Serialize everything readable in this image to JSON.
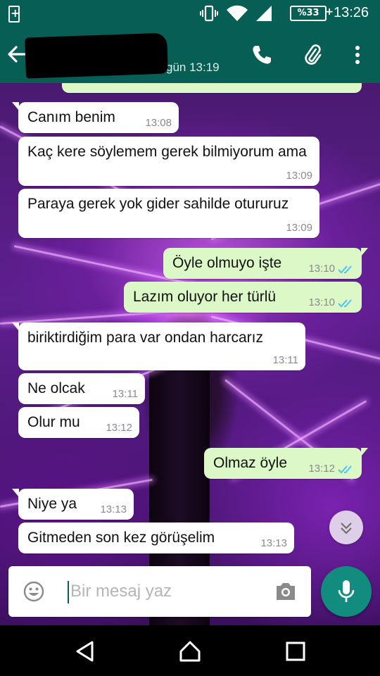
{
  "status_bar": {
    "battery_text": "%33",
    "time": "13:26"
  },
  "header": {
    "last_seen": "gün 13:19"
  },
  "messages": [
    {
      "dir": "in",
      "text": "Canım benim",
      "time": "13:08"
    },
    {
      "dir": "in",
      "text": "Kaç kere söylemem gerek bilmiyorum ama",
      "time": "13:09"
    },
    {
      "dir": "in",
      "text": "Paraya gerek yok gider sahilde otururuz",
      "time": "13:09"
    },
    {
      "dir": "out",
      "text": "Öyle olmuyo işte",
      "time": "13:10"
    },
    {
      "dir": "out",
      "text": "Lazım oluyor her türlü",
      "time": "13:10"
    },
    {
      "dir": "in",
      "text": "biriktirdiğim para var ondan harcarız",
      "time": "13:11"
    },
    {
      "dir": "in",
      "text": "Ne olcak",
      "time": "13:11"
    },
    {
      "dir": "in",
      "text": "Olur mu",
      "time": "13:12"
    },
    {
      "dir": "out",
      "text": "Olmaz öyle",
      "time": "13:12"
    },
    {
      "dir": "in",
      "text": "Niye ya",
      "time": "13:13"
    },
    {
      "dir": "in",
      "text": "Gitmeden son kez görüşelim",
      "time": "13:13"
    }
  ],
  "input": {
    "placeholder": "Bir mesaj yaz"
  },
  "colors": {
    "header": "#075e54",
    "outgoing": "#dcf8c6",
    "incoming": "#ffffff",
    "fab": "#128c7e",
    "read_ticks": "#4fc3f7"
  },
  "icons": [
    "back-arrow-icon",
    "phone-icon",
    "paperclip-icon",
    "more-vert-icon",
    "emoji-icon",
    "camera-icon",
    "mic-icon",
    "scroll-down-icon",
    "nav-back-icon",
    "nav-home-icon",
    "nav-recents-icon"
  ]
}
